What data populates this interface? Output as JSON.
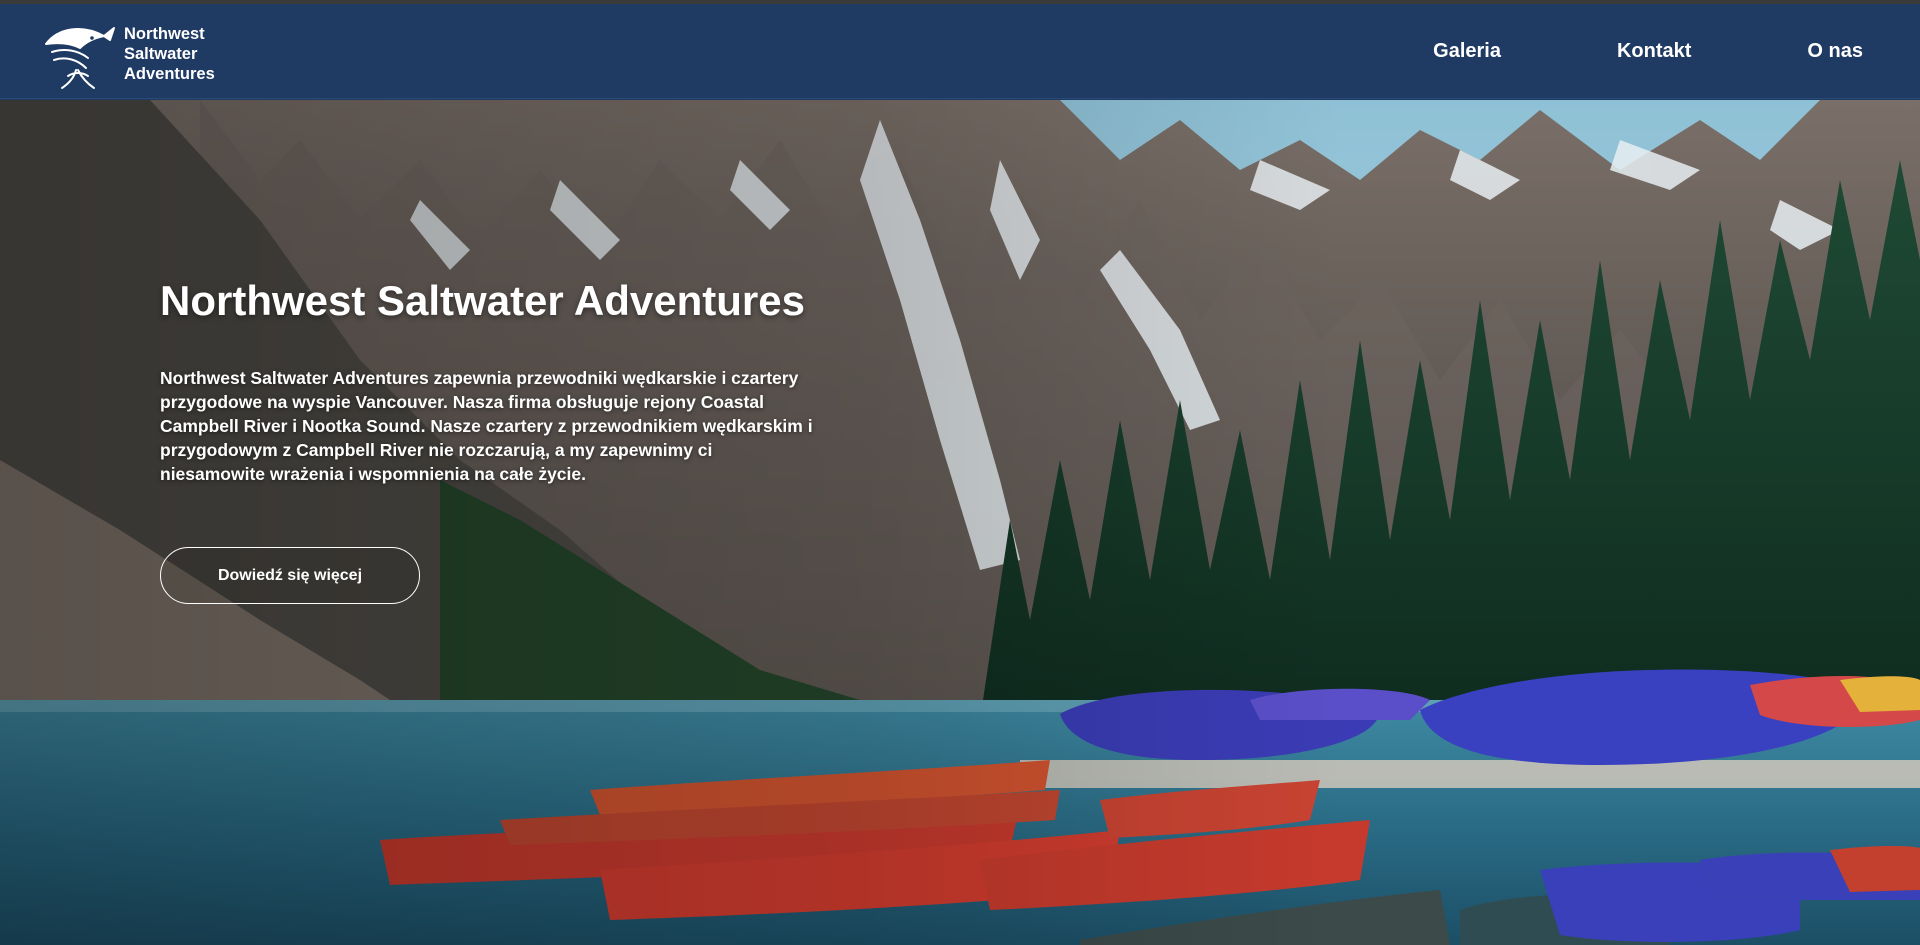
{
  "header": {
    "logo_lines": [
      "Northwest",
      "Saltwater",
      "Adventures"
    ],
    "logo_icon": "fish-logo-icon",
    "nav": [
      {
        "label": "Galeria"
      },
      {
        "label": "Kontakt"
      },
      {
        "label": "O nas"
      }
    ]
  },
  "hero": {
    "title": "Northwest Saltwater Adventures",
    "description": "Northwest Saltwater Adventures zapewnia przewodniki wędkarskie i czartery przygodowe na wyspie Vancouver. Nasza firma obsługuje rejony Coastal Campbell River i Nootka Sound. Nasze czartery z przewodnikiem wędkarskim i przygodowym z Campbell River nie rozczarują, a my zapewnimy ci niesamowite wrażenia i wspomnienia na całe życie.",
    "button_label": "Dowiedź się więcej",
    "image": "mountain-lake-canoes-photo"
  },
  "colors": {
    "header_bg": "#1f3a63",
    "text": "#ffffff"
  }
}
